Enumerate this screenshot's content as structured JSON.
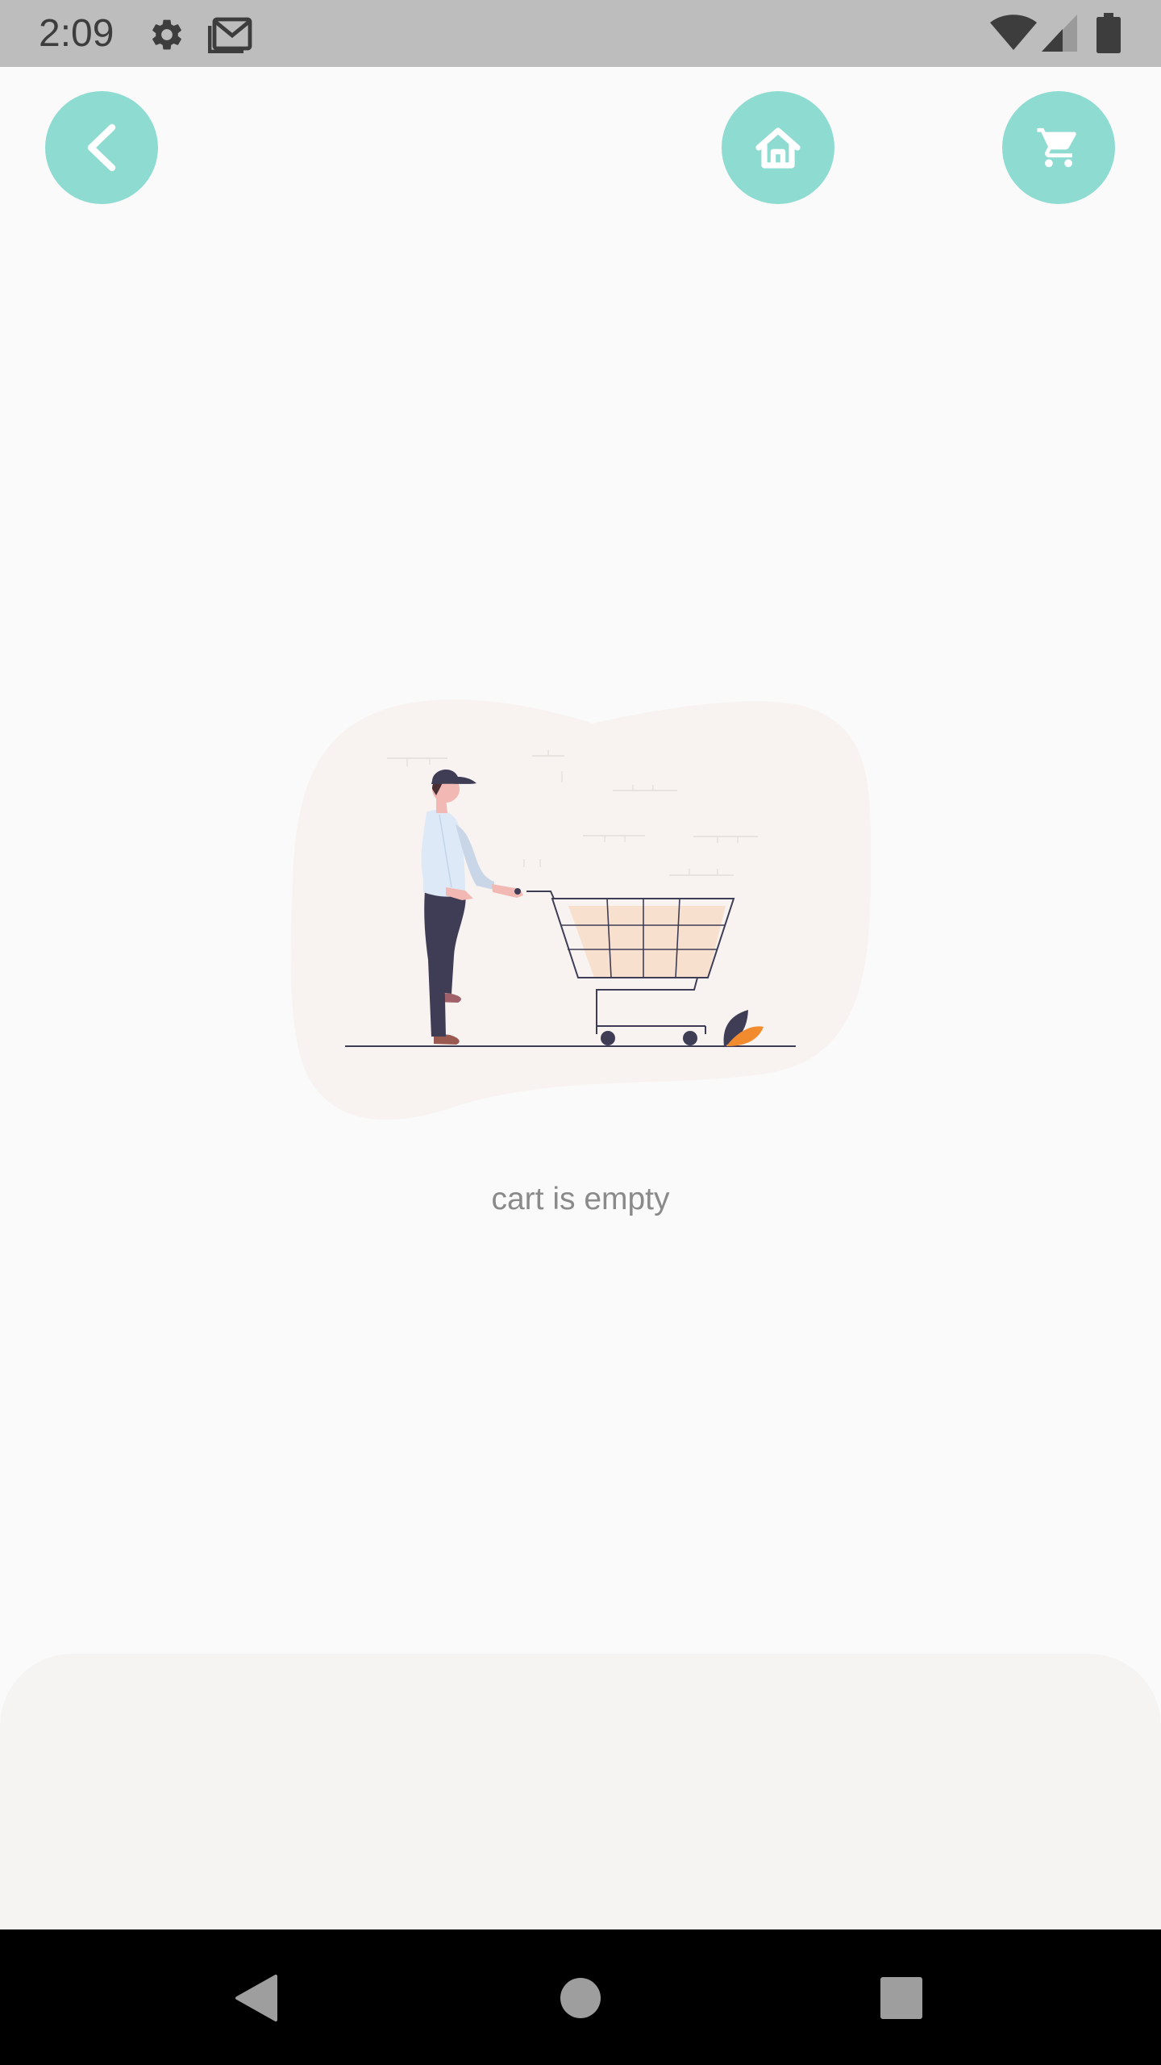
{
  "status_bar": {
    "time": "2:09",
    "icons": [
      "settings-icon",
      "gmail-icon",
      "wifi-icon",
      "signal-icon",
      "battery-icon"
    ]
  },
  "header": {
    "back_icon": "chevron-left-icon",
    "home_icon": "home-icon",
    "cart_icon": "cart-icon",
    "button_color": "#8edbd1"
  },
  "main": {
    "illustration": "empty-cart-illustration",
    "message": "cart is empty"
  },
  "colors": {
    "accent": "#8edbd1",
    "blob": "#f8f3f0",
    "cart_fill": "#f8e0cf",
    "leaf_orange": "#f28a2e",
    "dark_navy": "#3f3d56"
  },
  "nav": {
    "icons": [
      "back-triangle-icon",
      "home-circle-icon",
      "recents-square-icon"
    ]
  }
}
